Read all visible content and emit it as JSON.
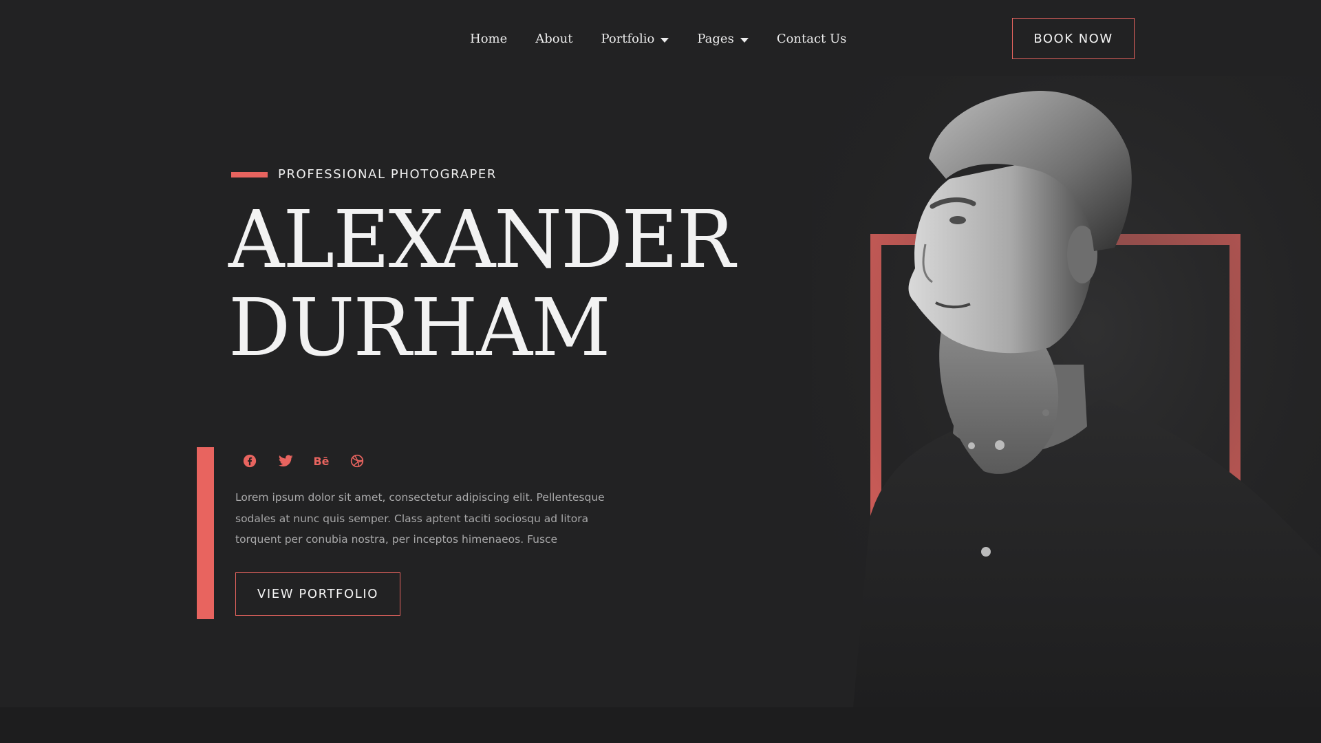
{
  "nav": {
    "items": [
      {
        "label": "Home",
        "dropdown": false
      },
      {
        "label": "About",
        "dropdown": false
      },
      {
        "label": "Portfolio",
        "dropdown": true
      },
      {
        "label": "Pages",
        "dropdown": true
      },
      {
        "label": "Contact Us",
        "dropdown": false
      }
    ],
    "book_label": "BOOK NOW"
  },
  "hero": {
    "eyebrow": "PROFESSIONAL PHOTOGRAPER",
    "name_line1": "ALEXANDER",
    "name_line2": "DURHAM",
    "description": "Lorem ipsum dolor sit amet, consectetur adipiscing elit. Pellentesque sodales at nunc quis semper. Class aptent taciti sociosqu ad litora torquent per conubia nostra, per inceptos himenaeos. Fusce",
    "cta_label": "VIEW PORTFOLIO"
  },
  "socials": {
    "items": [
      {
        "icon": "facebook-icon"
      },
      {
        "icon": "twitter-icon"
      },
      {
        "icon": "behance-icon",
        "text": "Bē"
      },
      {
        "icon": "dribbble-icon"
      }
    ]
  },
  "colors": {
    "accent": "#e8645f",
    "background": "#222223",
    "text": "#f2f2f2",
    "muted": "#a9a9aa"
  }
}
